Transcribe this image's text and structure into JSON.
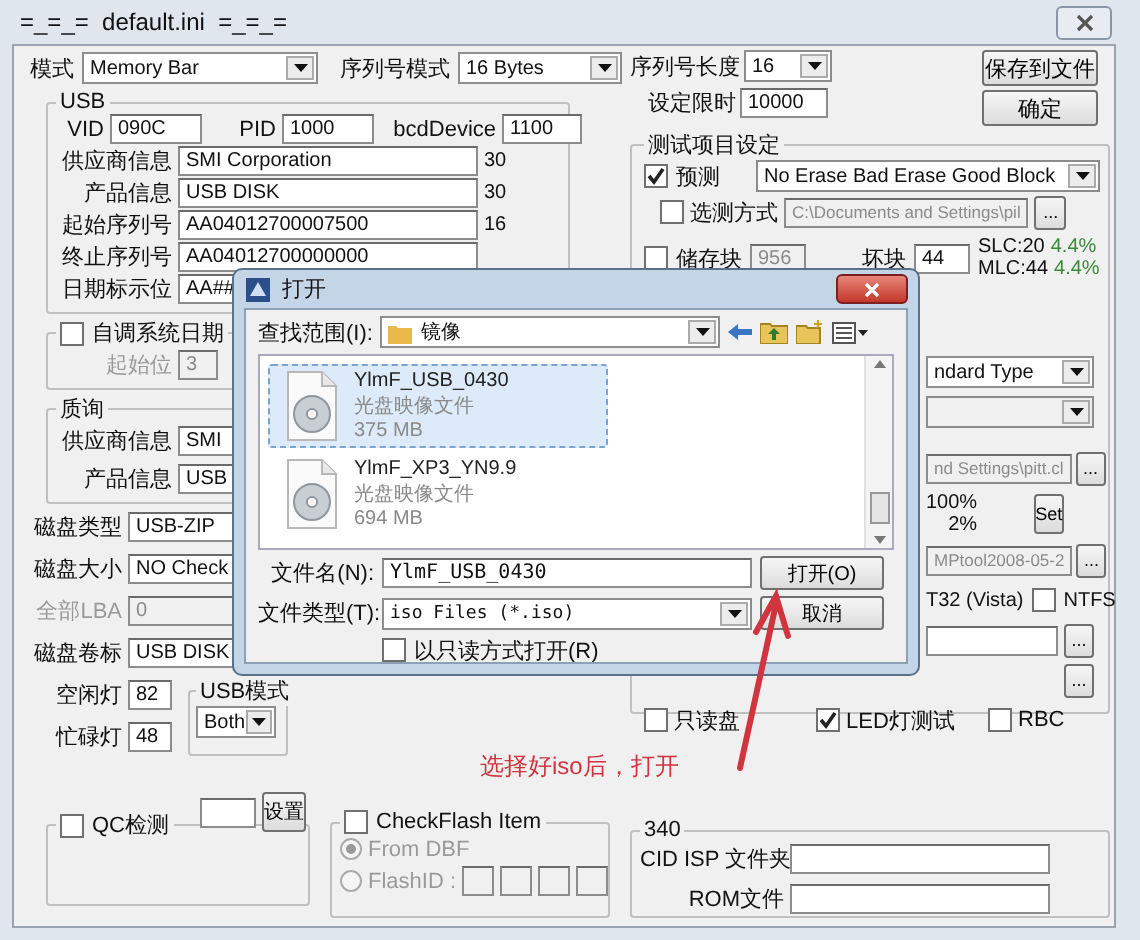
{
  "window": {
    "title": "=_=_=  default.ini  =_=_="
  },
  "mode": {
    "label": "模式",
    "value": "Memory Bar"
  },
  "serial_mode": {
    "label": "序列号模式",
    "value": "16 Bytes"
  },
  "serial_length": {
    "label": "序列号长度",
    "value": "16"
  },
  "time_limit": {
    "label": "设定限时",
    "value": "10000"
  },
  "buttons": [
    "保存到文件",
    "确定"
  ],
  "usb": {
    "title": "USB",
    "ids": [
      {
        "label": "VID",
        "value": "090C"
      },
      {
        "label": "PID",
        "value": "1000"
      },
      {
        "label": "bcdDevice",
        "value": "1100"
      }
    ],
    "fields": [
      {
        "label": "供应商信息",
        "value": "SMI Corporation",
        "length": "30"
      },
      {
        "label": "产品信息",
        "value": "USB DISK",
        "length": "30"
      },
      {
        "label": "起始序列号",
        "value": "AA04012700007500",
        "length": "16"
      },
      {
        "label": "终止序列号",
        "value": "AA04012700000000"
      },
      {
        "label": "日期标示位",
        "value": "AA##"
      }
    ]
  },
  "auto_date": {
    "label": "自调系统日期",
    "checked": false,
    "start_label": "起始位",
    "start_value": "3"
  },
  "inquiry": {
    "title": "质询",
    "fields": [
      {
        "label": "供应商信息",
        "value": "SMI"
      },
      {
        "label": "产品信息",
        "value": "USB"
      }
    ]
  },
  "disk": [
    {
      "label": "磁盘类型",
      "value": "USB-ZIP",
      "disabled": false
    },
    {
      "label": "磁盘大小",
      "value": "NO Check",
      "disabled": false
    },
    {
      "label": "全部LBA",
      "value": "0",
      "disabled": true
    },
    {
      "label": "磁盘卷标",
      "value": "USB DISK",
      "disabled": false
    }
  ],
  "lights": [
    {
      "label": "空闲灯",
      "value": "82"
    },
    {
      "label": "忙碌灯",
      "value": "48"
    }
  ],
  "usb_mode": {
    "title": "USB模式",
    "value": "Both"
  },
  "qc": {
    "label": "QC检测",
    "checked": false,
    "button": "设置"
  },
  "checkflash": {
    "label": "CheckFlash Item",
    "checked": false,
    "options": [
      {
        "label": "From DBF",
        "selected": true
      },
      {
        "label": "FlashID :",
        "selected": false
      }
    ]
  },
  "test": {
    "title": "测试项目设定",
    "precheck": {
      "label": "预测",
      "checked": true,
      "value": "No Erase Bad Erase Good Block"
    },
    "select_test": {
      "label": "选测方式",
      "checked": false,
      "path": "C:\\Documents and Settings\\pil",
      "browse": "..."
    },
    "storage": {
      "label": "储存块",
      "checked": false,
      "value": "956"
    },
    "bad_block": {
      "label": "坏块",
      "value": "44"
    },
    "ratios": [
      {
        "label": "SLC:20",
        "value": "4.4%"
      },
      {
        "label": "MLC:44",
        "value": "4.4%"
      }
    ],
    "type_value": "ndard Type",
    "type_path": {
      "value": "nd Settings\\pitt.cl",
      "browse": "..."
    },
    "percent_a": "100%",
    "percent_b": "2%",
    "set_button": "Set",
    "tool_path": {
      "value": "MPtool2008-05-2",
      "browse": "..."
    },
    "fat_label": "T32 (Vista)",
    "ntfs": {
      "label": "NTFS",
      "checked": false
    },
    "extra_browse": [
      "...",
      "..."
    ],
    "options": [
      {
        "label": "只读盘",
        "checked": false
      },
      {
        "label": "LED灯测试",
        "checked": true
      },
      {
        "label": "RBC",
        "checked": false
      }
    ]
  },
  "group_340": {
    "title": "340",
    "fields": [
      {
        "label": "CID ISP 文件夹"
      },
      {
        "label": "ROM文件"
      }
    ]
  },
  "annotation": "选择好iso后，打开",
  "dialog": {
    "title": "打开",
    "look_in": {
      "label": "查找范围(I):",
      "value": "镜像"
    },
    "files": [
      {
        "name": "YlmF_USB_0430",
        "type": "光盘映像文件",
        "size": "375 MB",
        "selected": true
      },
      {
        "name": "YlmF_XP3_YN9.9",
        "type": "光盘映像文件",
        "size": "694 MB",
        "selected": false
      }
    ],
    "file_name": {
      "label": "文件名(N):",
      "value": "YlmF_USB_0430"
    },
    "file_type": {
      "label": "文件类型(T):",
      "value": "iso Files (*.iso)"
    },
    "open_button": "打开(O)",
    "cancel_button": "取消",
    "read_only": {
      "label": "以只读方式打开(R)",
      "checked": false
    }
  }
}
